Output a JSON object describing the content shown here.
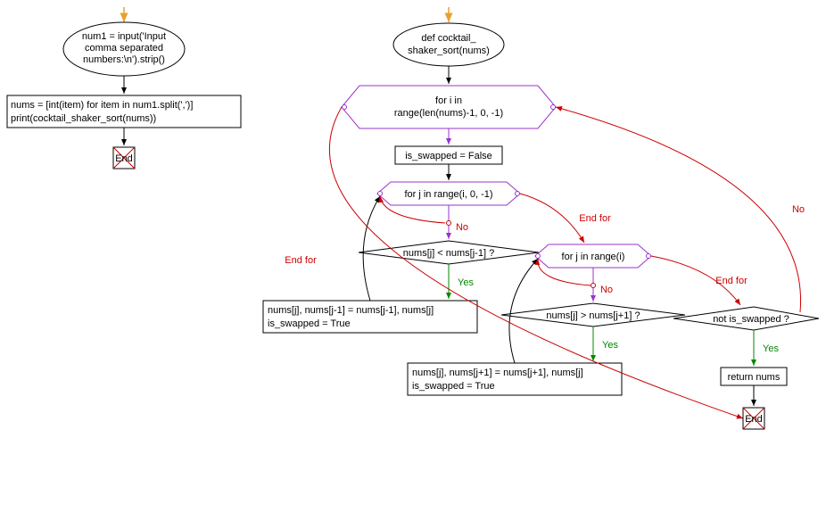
{
  "left": {
    "n1": "num1 = input('Input\ncomma separated\nnumbers:\\n').strip()",
    "n2": "nums = [int(item) for item in num1.split(',')]\nprint(cocktail_shaker_sort(nums))",
    "end": "End"
  },
  "right": {
    "funcdef": "def cocktail_\nshaker_sort(nums)",
    "for_i": "for i in\nrange(len(nums)-1, 0, -1)",
    "is_swapped_false": "is_swapped = False",
    "for_j1": "for j in range(i, 0, -1)",
    "cond1": "nums[j] < nums[j-1] ?",
    "swap1": "nums[j], nums[j-1] = nums[j-1], nums[j]\nis_swapped = True",
    "for_j2": "for j in range(i)",
    "cond2": "nums[j] > nums[j+1] ?",
    "swap2": "nums[j], nums[j+1] = nums[j+1], nums[j]\nis_swapped = True",
    "not_swapped": "not is_swapped ?",
    "return": "return nums",
    "end": "End"
  },
  "labels": {
    "yes": "Yes",
    "no": "No",
    "endfor": "End for"
  }
}
